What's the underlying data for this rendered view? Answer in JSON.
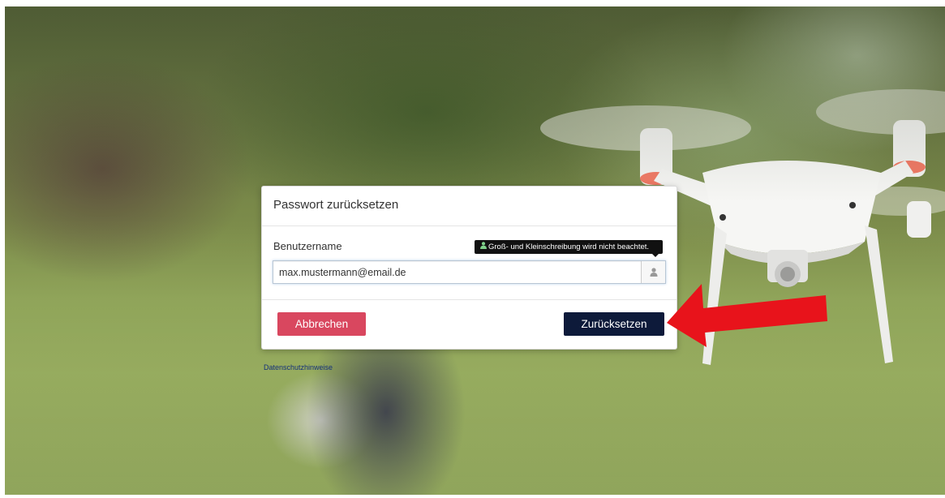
{
  "dialog": {
    "title": "Passwort zurücksetzen",
    "username_label": "Benutzername",
    "username_value": "max.mustermann@email.de",
    "tooltip_text": "Groß- und Kleinschreibung wird nicht beachtet.",
    "cancel_label": "Abbrechen",
    "submit_label": "Zurücksetzen"
  },
  "footer": {
    "privacy_link": "Datenschutzhinweise"
  },
  "colors": {
    "cancel_button": "#d9475f",
    "submit_button": "#0d1a3a",
    "annotation_arrow": "#e8131b"
  },
  "icons": {
    "input_addon": "user-icon",
    "tooltip": "user-icon",
    "annotation": "red-arrow"
  }
}
